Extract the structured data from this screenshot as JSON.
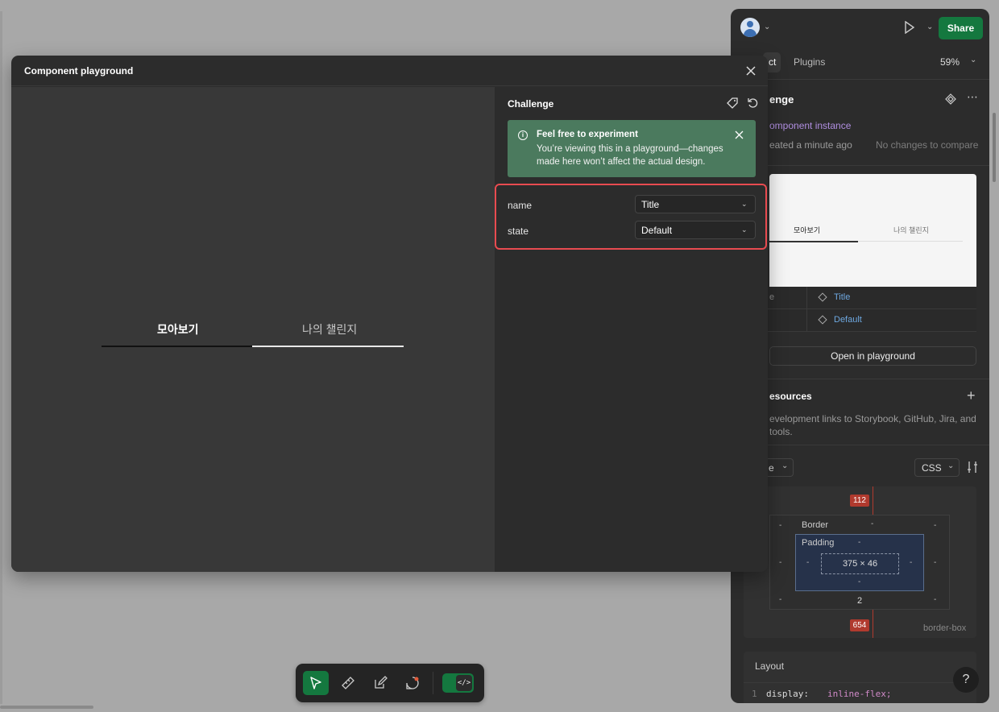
{
  "dialog": {
    "title": "Component playground",
    "preview_tabs": [
      "모아보기",
      "나의 챌린지"
    ],
    "side_title": "Challenge",
    "notice": {
      "title": "Feel free to experiment",
      "text": "You’re viewing this in a playground—changes made here won’t affect the actual design."
    },
    "props": [
      {
        "label": "name",
        "value": "Title"
      },
      {
        "label": "state",
        "value": "Default"
      }
    ],
    "accent_highlight": "#e84b50"
  },
  "inspector": {
    "share_label": "Share",
    "tabs": [
      "ct",
      "Plugins"
    ],
    "zoom": "59%",
    "component_name": "enge",
    "component_type": "omponent instance",
    "created": "eated a minute ago",
    "compare": "No changes to compare",
    "preview_tabs": [
      "모아보기",
      "나의 챌린지"
    ],
    "prop_labels": [
      "e",
      ""
    ],
    "prop_values": [
      "Title",
      "Default"
    ],
    "open_playground": "Open in playground",
    "resources_title": "esources",
    "resources_text_1": "evelopment links to Storybook, GitHub, Jira, and",
    "resources_text_2": "tools.",
    "code_select": "e",
    "lang_select": "CSS",
    "box_model": {
      "margin_top": "112",
      "margin_bottom": "654",
      "border_label": "Border",
      "padding_label": "Padding",
      "content_size": "375 × 46",
      "border_bottom": "2",
      "dash": "-",
      "sizing": "border-box"
    },
    "layout_title": "Layout",
    "code_line_no": "1",
    "code_prop": "display: ",
    "code_val": "inline-flex;",
    "help": "?"
  },
  "colors": {
    "share_green": "#14783f",
    "notice_green": "#4b7a5e",
    "badge_red": "#b03a2e"
  }
}
